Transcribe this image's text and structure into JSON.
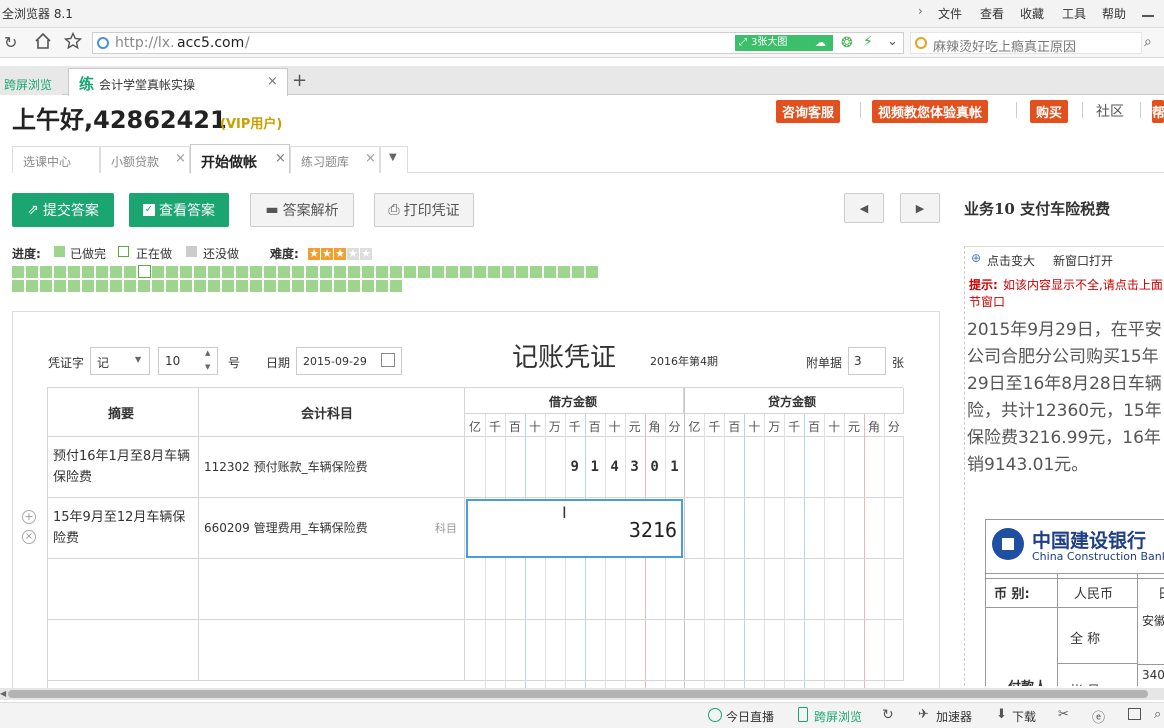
{
  "browser": {
    "title": "全浏览器 8.1",
    "menus": [
      "文件",
      "查看",
      "收藏",
      "工具",
      "帮助"
    ],
    "url_prefix": "http://lx.",
    "url_domain": "acc5.com",
    "url_suffix": "/",
    "bigpic_label": "3张大图",
    "search_placeholder": "麻辣烫好吃上瘾真正原因",
    "tabs": [
      {
        "label": "跨屏浏览"
      },
      {
        "label": "会计学堂真帐实操",
        "badge": "练"
      }
    ],
    "statusbar": [
      "今日直播",
      "跨屏浏览",
      "加速器",
      "下载"
    ]
  },
  "header": {
    "greeting": "上午好,42862421",
    "vip": "(VIP用户)",
    "top_buttons": [
      "咨询客服",
      "视频教您体验真帐",
      "购买"
    ],
    "community": "社区",
    "last_btn": "帮"
  },
  "page_tabs": [
    "选课中心",
    "小额贷款",
    "开始做帐",
    "练习题库"
  ],
  "toolbar": {
    "submit": "提交答案",
    "view": "查看答案",
    "analysis": "答案解析",
    "print": "打印凭证"
  },
  "progress": {
    "label": "进度:",
    "done": "已做完",
    "doing": "正在做",
    "todo": "还没做",
    "difficulty_label": "难度:",
    "difficulty_stars": 3,
    "difficulty_max": 5
  },
  "voucher": {
    "title": "记账凭证",
    "period": "2016年第4期",
    "word_label": "凭证字",
    "word_value": "记",
    "number_value": "10",
    "number_unit": "号",
    "date_label": "日期",
    "date_value": "2015-09-29",
    "attach_label": "附单据",
    "attach_value": "3",
    "attach_unit": "张",
    "col_summary": "摘要",
    "col_subject": "会计科目",
    "col_debit": "借方金额",
    "col_credit": "贷方金额",
    "digits": [
      "亿",
      "千",
      "百",
      "十",
      "万",
      "千",
      "百",
      "十",
      "元",
      "角",
      "分"
    ],
    "rows": [
      {
        "summary": "预付16年1月至8月车辆保险费",
        "subject": "112302 预付账款_车辆保险费",
        "debit": "914301"
      },
      {
        "summary": "15年9月至12月车辆保险费",
        "subject": "660209 管理费用_车辆保险费",
        "subject_hint": "科目",
        "debit_input": "3216"
      }
    ]
  },
  "right_panel": {
    "task_title": "业务10  支付车险税费",
    "zoom_label": "点击变大",
    "newwin_label": "新窗口打开",
    "tip_label": "提示:",
    "tip_text1": "如该内容显示不全,请点击上面",
    "tip_text2": "节窗口",
    "desc_lines": [
      "2015年9月29日，在平安",
      "公司合肥分公司购买15年",
      "29日至16年8月28日车辆",
      "险，共计12360元，15年",
      "保险费3216.99元，16年",
      "销9143.01元。"
    ],
    "bank_cn": "中国建设银行",
    "bank_en": "China Construction Bank",
    "bank_table": {
      "currency_label": "币  别:",
      "currency_value": "人民币",
      "currency_next": "日",
      "name_label": "全  称",
      "name_value": "安徽",
      "account_label": "帐  号",
      "account_value": "340",
      "payer_label": "付款人"
    }
  },
  "colors": {
    "green": "#1aa571",
    "orange": "#e2501d",
    "progress_done": "#9dd48e"
  }
}
